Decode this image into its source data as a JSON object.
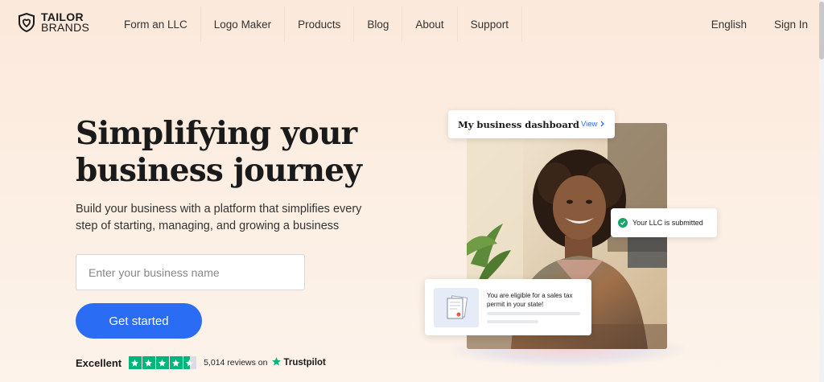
{
  "brand": {
    "line1": "TAILOR",
    "line2": "BRANDS",
    "icon": "shield-heart-icon"
  },
  "nav": {
    "items": [
      "Form an LLC",
      "Logo Maker",
      "Products",
      "Blog",
      "About",
      "Support"
    ],
    "language": "English",
    "sign_in": "Sign In"
  },
  "hero": {
    "headline_line1": "Simplifying your",
    "headline_line2": "business journey",
    "subtitle": "Build your business with a platform that simplifies every step of starting, managing, and growing a business",
    "input_placeholder": "Enter your business name",
    "input_value": "",
    "cta_label": "Get started"
  },
  "trust": {
    "rating_word": "Excellent",
    "stars": 4.5,
    "reviews_text": "5,014 reviews on",
    "brand": "Trustpilot",
    "color": "#00b67a"
  },
  "visual": {
    "dashboard_title": "My business dashboard",
    "dashboard_link": "View",
    "llc_status": "Your LLC is submitted",
    "tax_message": "You are eligible for a sales tax permit in your state!"
  },
  "colors": {
    "accent": "#2a6df4",
    "success": "#18a36b"
  }
}
